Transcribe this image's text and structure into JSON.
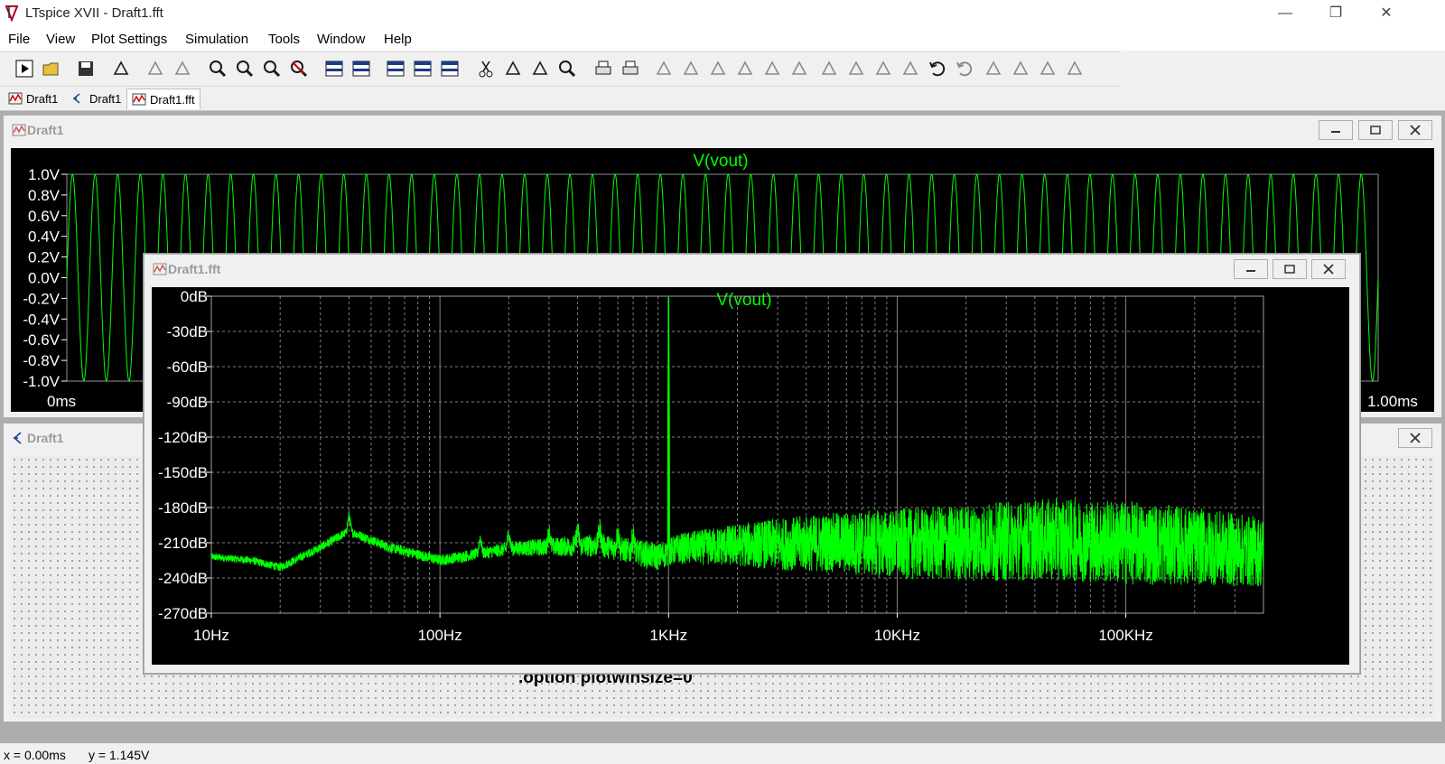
{
  "window": {
    "title": "LTspice XVII - Draft1.fft",
    "min": "—",
    "max": "❐",
    "close": "✕"
  },
  "menu": [
    "File",
    "View",
    "Plot Settings",
    "Simulation",
    "Tools",
    "Window",
    "Help"
  ],
  "tabs": [
    {
      "label": "Draft1",
      "icon": "waveform-icon"
    },
    {
      "label": "Draft1",
      "icon": "schematic-icon"
    },
    {
      "label": "Draft1.fft",
      "icon": "waveform-icon"
    }
  ],
  "time_window": {
    "title": "Draft1"
  },
  "schematic_window": {
    "title": "Draft1",
    "directive": ".option plotwinsize=0"
  },
  "fft_window": {
    "title": "Draft1.fft"
  },
  "status": {
    "x": "x = 0.00ms",
    "y": "y = 1.145V"
  },
  "colors": {
    "trace": "#00ff00",
    "plot_bg": "#000000",
    "grid": "#808080"
  },
  "chart_data": [
    {
      "type": "line",
      "title": "V(vout)",
      "series": [
        {
          "name": "V(vout)",
          "description": "sine wave oscillating between -1.0V and 1.0V, ~58 cycles across visible span"
        }
      ],
      "y_ticks": [
        "1.0V",
        "0.8V",
        "0.6V",
        "0.4V",
        "0.2V",
        "0.0V",
        "-0.2V",
        "-0.4V",
        "-0.6V",
        "-0.8V",
        "-1.0V"
      ],
      "x_ticks": [
        "0ms",
        "1.00ms"
      ],
      "ylim": [
        -1.0,
        1.0
      ],
      "xlim": [
        0,
        1.0
      ],
      "cycles": 58,
      "grid": true
    },
    {
      "type": "line",
      "title": "V(vout)",
      "x_scale": "log",
      "xlim": [
        10,
        400000
      ],
      "ylim": [
        -270,
        0
      ],
      "y_ticks": [
        "0dB",
        "-30dB",
        "-60dB",
        "-90dB",
        "-120dB",
        "-150dB",
        "-180dB",
        "-210dB",
        "-240dB",
        "-270dB"
      ],
      "y_tick_values": [
        0,
        -30,
        -60,
        -90,
        -120,
        -150,
        -180,
        -210,
        -240,
        -270
      ],
      "x_ticks": [
        "10Hz",
        "100Hz",
        "1KHz",
        "10KHz",
        "100KHz"
      ],
      "x_tick_values": [
        10,
        100,
        1000,
        10000,
        100000
      ],
      "peak": {
        "x": 1000,
        "y": -1
      },
      "noise_floor": [
        [
          10,
          -222
        ],
        [
          15,
          -225
        ],
        [
          20,
          -231
        ],
        [
          30,
          -214
        ],
        [
          40,
          -200
        ],
        [
          60,
          -214
        ],
        [
          80,
          -220
        ],
        [
          100,
          -225
        ],
        [
          200,
          -215
        ],
        [
          500,
          -212
        ],
        [
          900,
          -222
        ],
        [
          1100,
          -215
        ],
        [
          2000,
          -212
        ],
        [
          5000,
          -210
        ],
        [
          10000,
          -211
        ],
        [
          20000,
          -210
        ],
        [
          50000,
          -207
        ],
        [
          100000,
          -210
        ],
        [
          200000,
          -213
        ],
        [
          400000,
          -218
        ]
      ],
      "noise_spread": [
        [
          10,
          3
        ],
        [
          150,
          5
        ],
        [
          500,
          10
        ],
        [
          1000,
          12
        ],
        [
          3000,
          22
        ],
        [
          10000,
          30
        ],
        [
          30000,
          34
        ],
        [
          100000,
          36
        ],
        [
          400000,
          30
        ]
      ],
      "grid": true
    }
  ]
}
